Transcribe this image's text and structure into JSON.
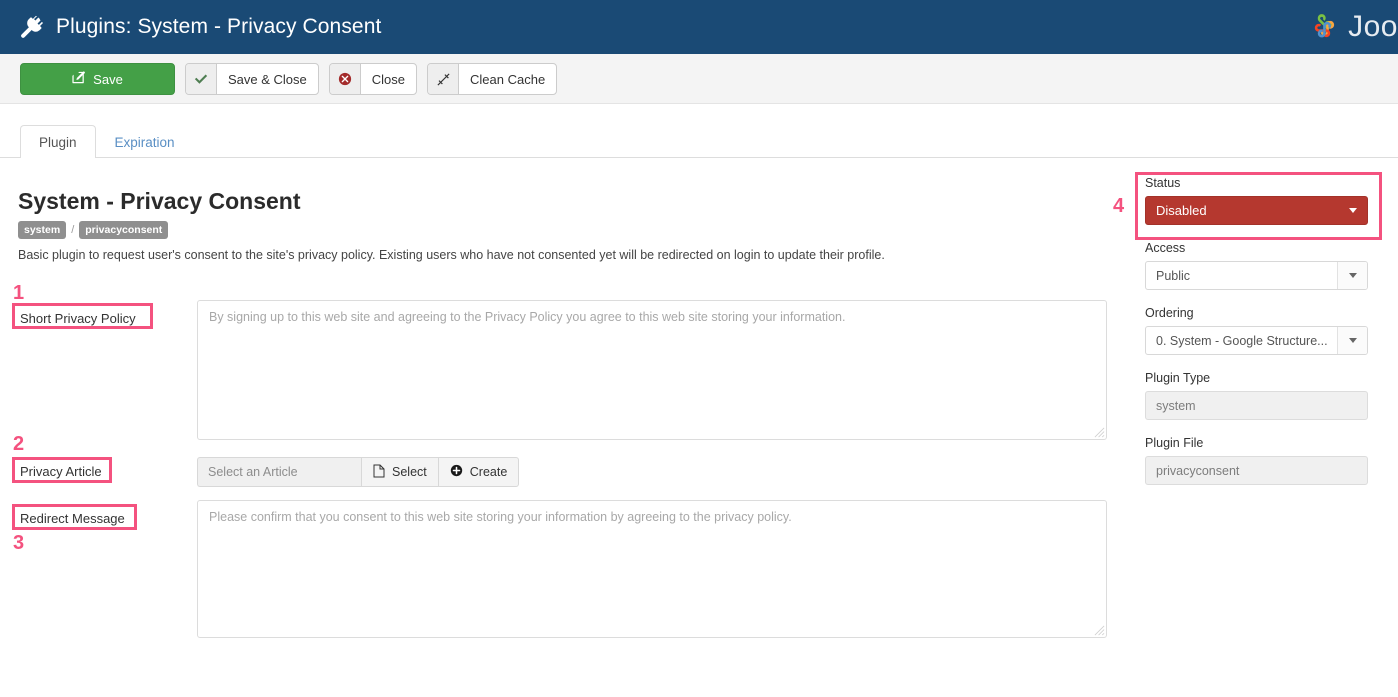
{
  "header": {
    "icon": "plug-icon",
    "title": "Plugins: System - Privacy Consent",
    "brand_text": "Joo",
    "brand_logo": "joomla-logo-icon",
    "bg_color": "#1a4a75"
  },
  "toolbar": {
    "save_label": "Save",
    "save_icon": "pencil-square-icon",
    "save_color": "#44a047",
    "save_close_label": "Save & Close",
    "save_close_icon": "check-icon",
    "close_label": "Close",
    "close_icon": "cancel-circle-icon",
    "clean_cache_label": "Clean Cache",
    "clean_cache_icon": "broom-icon"
  },
  "tabs": [
    {
      "label": "Plugin",
      "active": true
    },
    {
      "label": "Expiration",
      "active": false
    }
  ],
  "main": {
    "page_title": "System - Privacy Consent",
    "badge_type": "system",
    "badge_separator": "/",
    "badge_file": "privacyconsent",
    "description": "Basic plugin to request user's consent to the site's privacy policy. Existing users who have not consented yet will be redirected on login to update their profile.",
    "fields": {
      "short_privacy_policy": {
        "label": "Short Privacy Policy",
        "value": "",
        "placeholder": "By signing up to this web site and agreeing to the Privacy Policy you agree to this web site storing your information."
      },
      "privacy_article": {
        "label": "Privacy Article",
        "value": "",
        "placeholder": "Select an Article",
        "select_button": "Select",
        "select_icon": "file-icon",
        "create_button": "Create",
        "create_icon": "plus-circle-icon"
      },
      "redirect_message": {
        "label": "Redirect Message",
        "value": "",
        "placeholder": "Please confirm that you consent to this web site storing your information by agreeing to the privacy policy."
      }
    }
  },
  "sidebar": {
    "status": {
      "label": "Status",
      "value": "Disabled",
      "color": "#b5382f"
    },
    "access": {
      "label": "Access",
      "value": "Public"
    },
    "ordering": {
      "label": "Ordering",
      "value": "0. System - Google Structure..."
    },
    "plugin_type": {
      "label": "Plugin Type",
      "value": "system"
    },
    "plugin_file": {
      "label": "Plugin File",
      "value": "privacyconsent"
    }
  },
  "annotations": {
    "color": "#f4527f",
    "markers": [
      {
        "number": "1",
        "target": "short-privacy-policy-label"
      },
      {
        "number": "2",
        "target": "privacy-article-label"
      },
      {
        "number": "3",
        "target": "redirect-message-label"
      },
      {
        "number": "4",
        "target": "status-field"
      }
    ]
  }
}
